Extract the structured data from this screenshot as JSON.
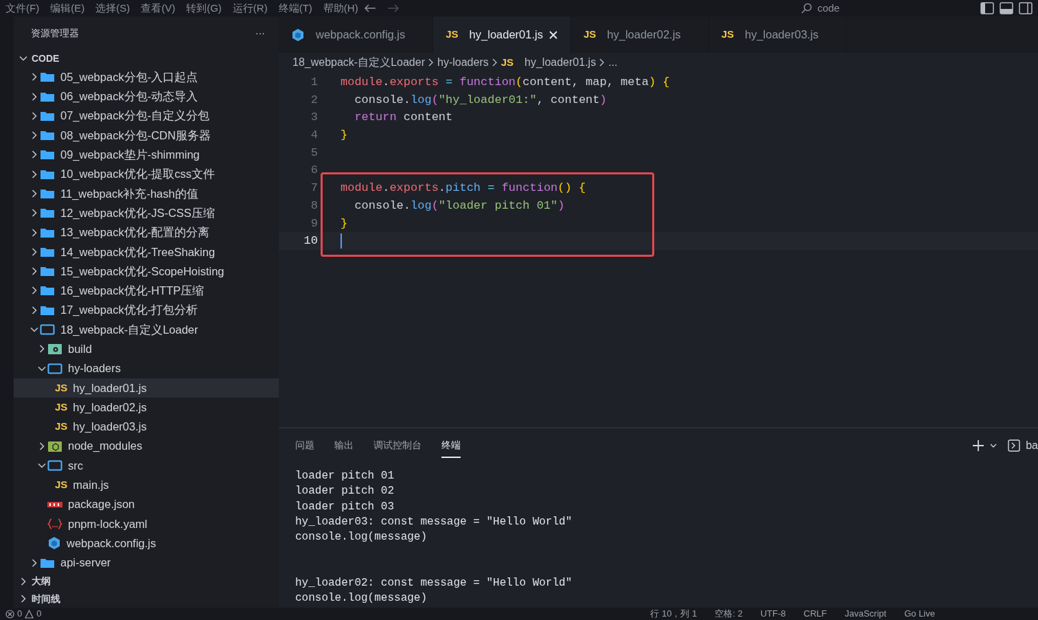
{
  "menu": [
    "文件(F)",
    "编辑(E)",
    "选择(S)",
    "查看(V)",
    "转到(G)",
    "运行(R)",
    "终端(T)",
    "帮助(H)"
  ],
  "search": {
    "value": "code"
  },
  "sidebar": {
    "title": "资源管理器",
    "more": "···",
    "root": {
      "label": "CODE",
      "expanded": true,
      "children": [
        {
          "label": "05_webpack分包-入口起点",
          "kind": "folder",
          "expanded": false
        },
        {
          "label": "06_webpack分包-动态导入",
          "kind": "folder",
          "expanded": false
        },
        {
          "label": "07_webpack分包-自定义分包",
          "kind": "folder",
          "expanded": false
        },
        {
          "label": "08_webpack分包-CDN服务器",
          "kind": "folder",
          "expanded": false
        },
        {
          "label": "09_webpack垫片-shimming",
          "kind": "folder",
          "expanded": false
        },
        {
          "label": "10_webpack优化-提取css文件",
          "kind": "folder",
          "expanded": false
        },
        {
          "label": "11_webpack补充-hash的值",
          "kind": "folder",
          "expanded": false
        },
        {
          "label": "12_webpack优化-JS-CSS压缩",
          "kind": "folder",
          "expanded": false
        },
        {
          "label": "13_webpack优化-配置的分离",
          "kind": "folder",
          "expanded": false
        },
        {
          "label": "14_webpack优化-TreeShaking",
          "kind": "folder",
          "expanded": false
        },
        {
          "label": "15_webpack优化-ScopeHoisting",
          "kind": "folder",
          "expanded": false
        },
        {
          "label": "16_webpack优化-HTTP压缩",
          "kind": "folder",
          "expanded": false
        },
        {
          "label": "17_webpack优化-打包分析",
          "kind": "folder",
          "expanded": false
        },
        {
          "label": "18_webpack-自定义Loader",
          "kind": "folder",
          "expanded": true,
          "children": [
            {
              "label": "build",
              "kind": "build",
              "expanded": false
            },
            {
              "label": "hy-loaders",
              "kind": "folder",
              "expanded": true,
              "children": [
                {
                  "label": "hy_loader01.js",
                  "kind": "js",
                  "icon_text": "JS",
                  "selected": true
                },
                {
                  "label": "hy_loader02.js",
                  "kind": "js",
                  "icon_text": "JS",
                  "selected": false
                },
                {
                  "label": "hy_loader03.js",
                  "kind": "js",
                  "icon_text": "JS",
                  "selected": false
                }
              ]
            },
            {
              "label": "node_modules",
              "kind": "node",
              "expanded": false
            },
            {
              "label": "src",
              "kind": "folder",
              "expanded": true,
              "children": [
                {
                  "label": "main.js",
                  "kind": "js",
                  "icon_text": "JS",
                  "selected": false
                }
              ]
            },
            {
              "label": "package.json",
              "kind": "npm",
              "selected": false
            },
            {
              "label": "pnpm-lock.yaml",
              "kind": "yaml",
              "selected": false
            },
            {
              "label": "webpack.config.js",
              "kind": "webpack",
              "selected": false
            }
          ]
        },
        {
          "label": "api-server",
          "kind": "folder",
          "expanded": false
        }
      ]
    },
    "sections": [
      {
        "label": "大纲",
        "expanded": false
      },
      {
        "label": "时间线",
        "expanded": false
      }
    ]
  },
  "tabs": [
    {
      "label": "webpack.config.js",
      "kind": "webpack",
      "selected": false
    },
    {
      "label": "hy_loader01.js",
      "kind": "js",
      "icon_text": "JS",
      "selected": true
    },
    {
      "label": "hy_loader02.js",
      "kind": "js",
      "icon_text": "JS",
      "selected": false
    },
    {
      "label": "hy_loader03.js",
      "kind": "js",
      "icon_text": "JS",
      "selected": false
    }
  ],
  "breadcrumb": [
    {
      "label": "18_webpack-自定义Loader"
    },
    {
      "label": "hy-loaders"
    },
    {
      "label": "hy_loader01.js",
      "kind": "js",
      "icon_text": "JS"
    },
    {
      "label": "..."
    }
  ],
  "code_blocks": [
    {
      "boxed": false,
      "lines": [
        {
          "number": "1",
          "current": false,
          "tokens": [
            {
              "t": "module",
              "kind": "variable"
            },
            {
              "t": ".",
              "kind": "plain"
            },
            {
              "t": "exports",
              "kind": "property"
            },
            {
              "t": " = ",
              "kind": "operator"
            },
            {
              "t": "function",
              "kind": "keyword"
            },
            {
              "t": "(",
              "kind": "bracket"
            },
            {
              "t": "content, map, meta",
              "kind": "plain"
            },
            {
              "t": ")",
              "kind": "bracket"
            },
            {
              "t": " {",
              "kind": "bracket"
            }
          ]
        },
        {
          "number": "2",
          "current": false,
          "tokens": [
            {
              "t": "  console",
              "kind": "plain"
            },
            {
              "t": ".",
              "kind": "plain"
            },
            {
              "t": "log",
              "kind": "function"
            },
            {
              "t": "(",
              "kind": "bracket2"
            },
            {
              "t": "\"hy_loader01:\"",
              "kind": "string"
            },
            {
              "t": ", content",
              "kind": "plain"
            },
            {
              "t": ")",
              "kind": "bracket2"
            }
          ]
        },
        {
          "number": "3",
          "current": false,
          "tokens": [
            {
              "t": "  return",
              "kind": "keyword"
            },
            {
              "t": " content",
              "kind": "plain"
            }
          ]
        },
        {
          "number": "4",
          "current": false,
          "tokens": [
            {
              "t": "}",
              "kind": "bracket"
            }
          ]
        },
        {
          "number": "5",
          "current": false
        },
        {
          "number": "6",
          "current": false
        }
      ]
    },
    {
      "boxed": true,
      "lines": [
        {
          "number": "7",
          "current": false,
          "tokens": [
            {
              "t": "module",
              "kind": "variable"
            },
            {
              "t": ".",
              "kind": "plain"
            },
            {
              "t": "exports",
              "kind": "property"
            },
            {
              "t": ".",
              "kind": "plain"
            },
            {
              "t": "pitch",
              "kind": "function"
            },
            {
              "t": " = ",
              "kind": "operator"
            },
            {
              "t": "function",
              "kind": "keyword"
            },
            {
              "t": "()",
              "kind": "bracket"
            },
            {
              "t": " {",
              "kind": "bracket"
            }
          ]
        },
        {
          "number": "8",
          "current": false,
          "tokens": [
            {
              "t": "  console",
              "kind": "plain"
            },
            {
              "t": ".",
              "kind": "plain"
            },
            {
              "t": "log",
              "kind": "function"
            },
            {
              "t": "(",
              "kind": "bracket2"
            },
            {
              "t": "\"loader pitch 01\"",
              "kind": "string"
            },
            {
              "t": ")",
              "kind": "bracket2"
            }
          ]
        },
        {
          "number": "9",
          "current": false,
          "tokens": [
            {
              "t": "}",
              "kind": "bracket"
            }
          ]
        },
        {
          "number": "10",
          "current": true
        }
      ]
    }
  ],
  "panel": {
    "tabs": [
      {
        "label": "问题",
        "selected": false
      },
      {
        "label": "输出",
        "selected": false
      },
      {
        "label": "调试控制台",
        "selected": false
      },
      {
        "label": "终端",
        "selected": true
      }
    ],
    "terminal_name": "ba",
    "lines": [
      {
        "text": "loader pitch 01",
        "gap_before": false
      },
      {
        "text": "loader pitch 02",
        "gap_before": false
      },
      {
        "text": "loader pitch 03",
        "gap_before": false
      },
      {
        "text": "hy_loader03: const message = \"Hello World\"",
        "gap_before": false
      },
      {
        "text": "console.log(message)",
        "gap_before": false
      },
      {
        "text": "hy_loader02: const message = \"Hello World\"",
        "gap_before": true
      },
      {
        "text": "console.log(message)",
        "gap_before": false
      }
    ]
  },
  "status_bar": {
    "errors": "0",
    "warnings": "0",
    "items": [
      "行 10，列 1",
      "空格: 2",
      "UTF-8",
      "CRLF",
      "JavaScript",
      "Go Live"
    ]
  }
}
